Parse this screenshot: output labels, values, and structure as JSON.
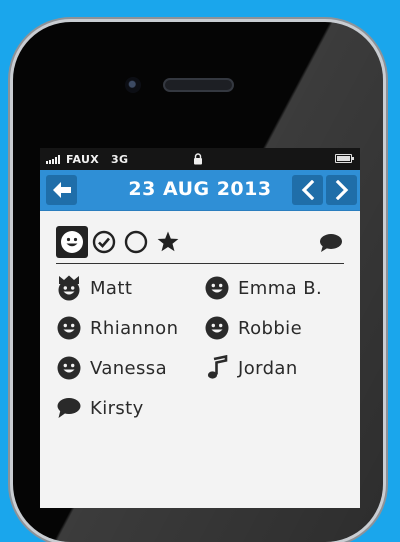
{
  "status_bar": {
    "carrier": "FAUX",
    "network": "3G"
  },
  "nav": {
    "date_title": "23 AUG 2013"
  },
  "filters": [
    {
      "icon": "smiley-icon",
      "active": true
    },
    {
      "icon": "check-circle-icon",
      "active": false
    },
    {
      "icon": "empty-circle-icon",
      "active": false
    },
    {
      "icon": "star-icon",
      "active": false
    }
  ],
  "filter_right_icon": "comment-icon",
  "people": [
    {
      "name": "Matt",
      "icon": "crown-smiley-icon"
    },
    {
      "name": "Emma B.",
      "icon": "smiley-icon"
    },
    {
      "name": "Rhiannon",
      "icon": "smiley-icon"
    },
    {
      "name": "Robbie",
      "icon": "smiley-icon"
    },
    {
      "name": "Vanessa",
      "icon": "smiley-icon"
    },
    {
      "name": "Jordan",
      "icon": "music-note-icon"
    },
    {
      "name": "Kirsty",
      "icon": "comment-icon"
    }
  ],
  "colors": {
    "background": "#1aa6ec",
    "nav_bar": "#2f8fd6",
    "nav_button": "#1f6ea9",
    "icon_dark": "#2a2a2a"
  }
}
